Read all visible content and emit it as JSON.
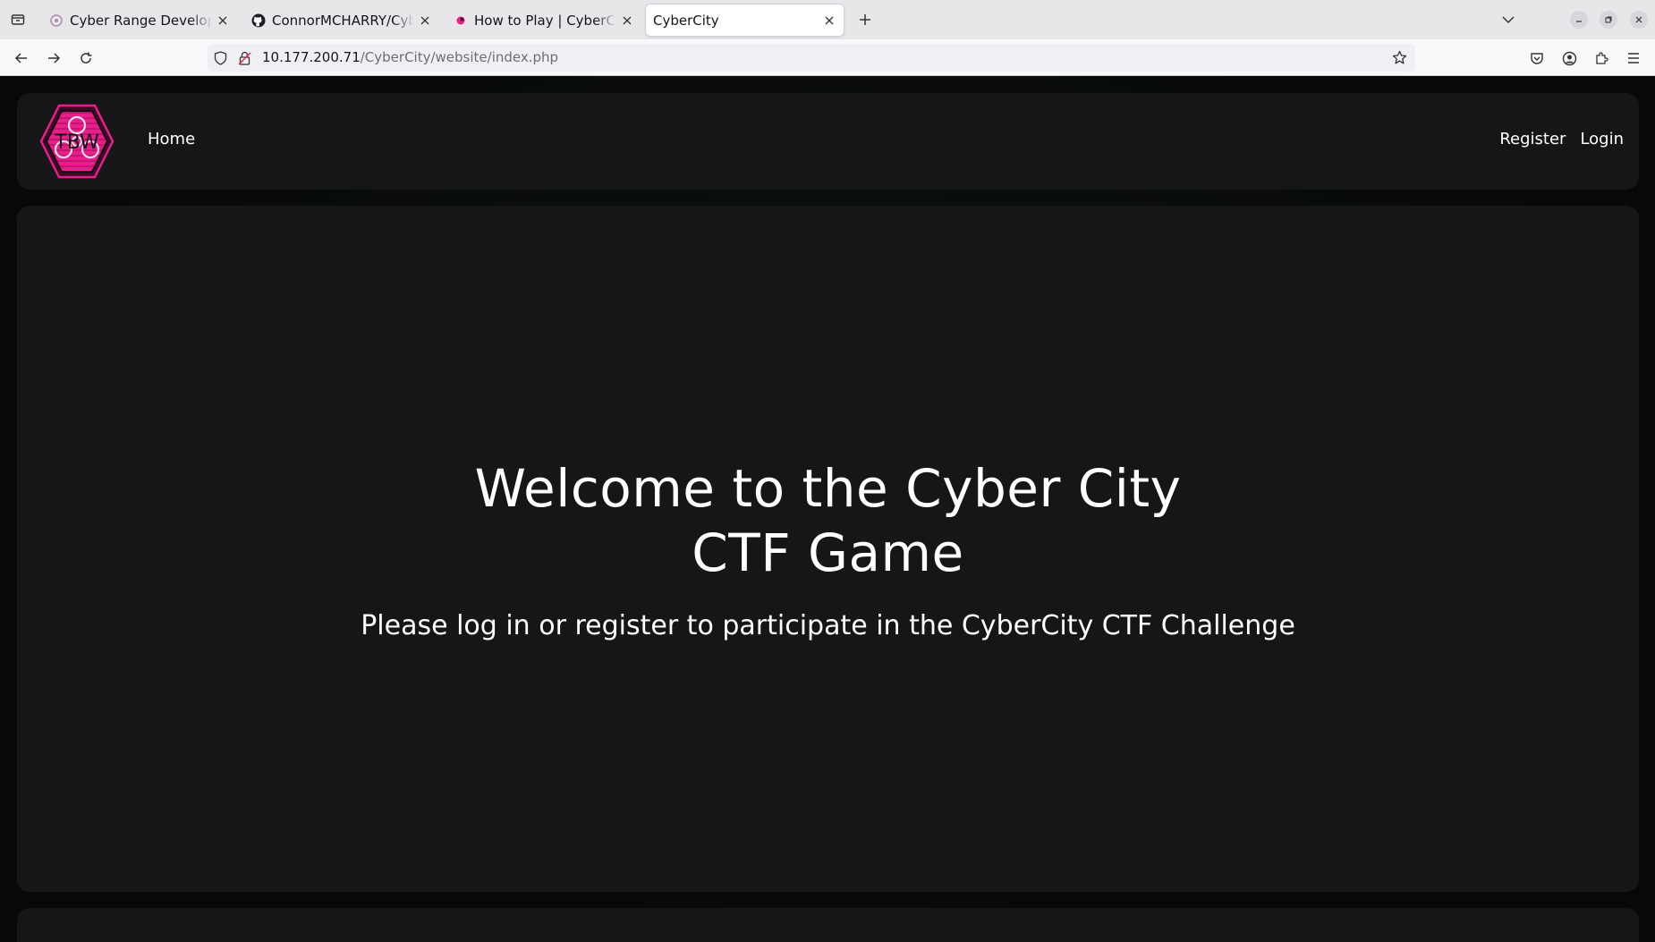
{
  "browser": {
    "tabs": [
      {
        "title": "Cyber Range Development",
        "favicon": "cyber-range-favicon",
        "active": false
      },
      {
        "title": "ConnorMCHARRY/CyberCity",
        "favicon": "github-icon",
        "active": false
      },
      {
        "title": "How to Play | CyberCity M",
        "favicon": "cybercity-favicon",
        "active": false
      },
      {
        "title": "CyberCity",
        "favicon": "",
        "active": true
      }
    ],
    "url": {
      "host": "10.177.200.71",
      "path": "/CyberCity/website/index.php"
    }
  },
  "site": {
    "logo_text": "TBW",
    "nav": {
      "home": "Home",
      "register": "Register",
      "login": "Login"
    },
    "hero": {
      "title": "Welcome to the Cyber City CTF Game",
      "subtitle": "Please log in or register to participate in the CyberCity CTF Challenge"
    }
  },
  "colors": {
    "logo_pink": "#e91e8c",
    "panel_bg": "#141617",
    "page_bg": "#070907",
    "text": "#ffffff"
  }
}
